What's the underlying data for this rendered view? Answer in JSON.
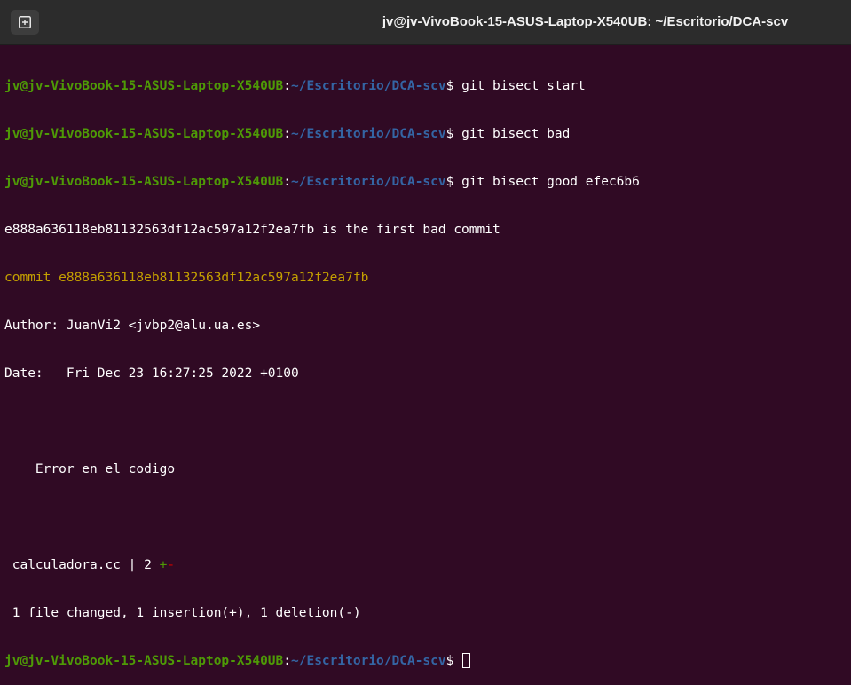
{
  "window": {
    "title": "jv@jv-VivoBook-15-ASUS-Laptop-X540UB: ~/Escritorio/DCA-scv",
    "new_tab_icon": "new-tab-icon"
  },
  "prompt": {
    "user_host": "jv@jv-VivoBook-15-ASUS-Laptop-X540UB",
    "colon": ":",
    "path": "~/Escritorio/DCA-scv",
    "symbol": "$"
  },
  "colors": {
    "background": "#300a24",
    "prompt_user": "#4e9a06",
    "prompt_path": "#3465a4",
    "commit_line": "#c4a000",
    "insertion": "#4e9a06",
    "deletion": "#cc0000"
  },
  "commands": [
    " git bisect start",
    " git bisect bad",
    " git bisect good efec6b6"
  ],
  "output": {
    "first_bad": "e888a636118eb81132563df12ac597a12f2ea7fb is the first bad commit",
    "commit_line": "commit e888a636118eb81132563df12ac597a12f2ea7fb",
    "author": "Author: JuanVi2 <jvbp2@alu.ua.es>",
    "date": "Date:   Fri Dec 23 16:27:25 2022 +0100",
    "blank": "",
    "message": "    Error en el codigo",
    "stat_file": " calculadora.cc | 2 ",
    "stat_plus": "+",
    "stat_minus": "-",
    "summary": " 1 file changed, 1 insertion(+), 1 deletion(-)"
  }
}
